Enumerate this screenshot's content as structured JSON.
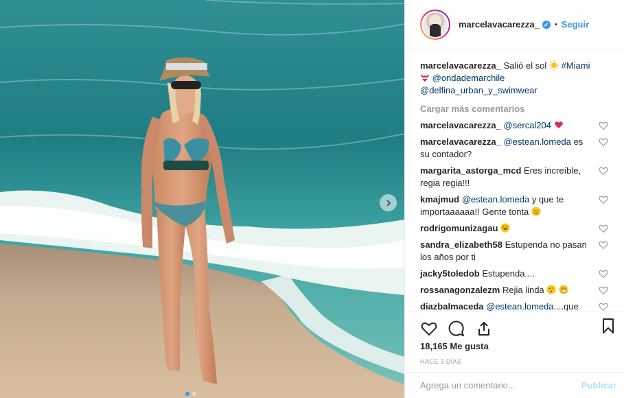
{
  "header": {
    "username": "marcelavacarezza_",
    "verified_mark": "✔",
    "separator": "•",
    "follow_label": "Seguir"
  },
  "caption": {
    "username": "marcelavacarezza_",
    "text": "Salió el sol",
    "hashtag": "#Miami",
    "mention_1": "@ondademarchile",
    "mention_2": "@delfina_urban_y_swimwear"
  },
  "load_more_label": "Cargar más comentarios",
  "comments": [
    {
      "user": "marcelavacarezza_",
      "mention": "@sercal204",
      "text": ""
    },
    {
      "user": "marcelavacarezza_",
      "mention": "@estean.lomeda",
      "text": "es su contador?"
    },
    {
      "user": "margarita_astorga_mcd",
      "mention": "",
      "text": "Eres increíble, regia regia!!!"
    },
    {
      "user": "kmajmud",
      "mention": "@estean.lomeda",
      "text": "y que te importaaaaaa!! Gente tonta"
    },
    {
      "user": "rodrigomunizagau",
      "mention": "",
      "text": ""
    },
    {
      "user": "sandra_elizabeth58",
      "mention": "",
      "text": "Estupenda no pasan los años por ti"
    },
    {
      "user": "jacky5toledob",
      "mention": "",
      "text": "Estupenda...."
    },
    {
      "user": "rossanagonzalezm",
      "mention": "",
      "text": "Rejia linda"
    },
    {
      "user": "diazbalmaceda",
      "mention": "@estean.lomeda",
      "text": "....que"
    }
  ],
  "likes": "18,165 Me gusta",
  "timestamp": "HACE 3 DÍAS",
  "add_comment": {
    "placeholder": "Agrega un comentario...",
    "publish_label": "Publicar"
  },
  "icons": {
    "like": "heart-icon",
    "comment": "comment-icon",
    "share": "share-icon",
    "save": "bookmark-icon",
    "next": "chevron-right-icon"
  },
  "colors": {
    "link": "#3897f0",
    "mention": "#003569",
    "muted": "#999999",
    "heart_red": "#ed4956"
  }
}
